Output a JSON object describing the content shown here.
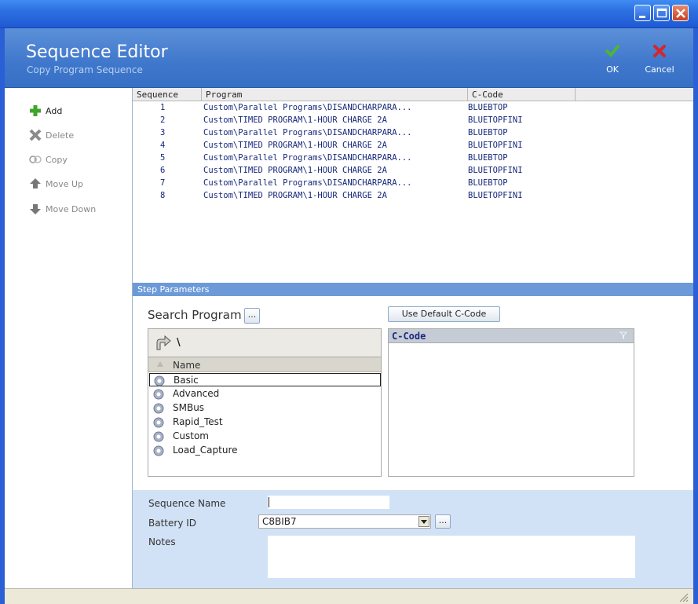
{
  "header": {
    "title": "Sequence Editor",
    "subtitle": "Copy Program Sequence",
    "ok_label": "OK",
    "cancel_label": "Cancel"
  },
  "sidebar": {
    "items": [
      {
        "label": "Add",
        "icon": "plus-icon",
        "enabled": true
      },
      {
        "label": "Delete",
        "icon": "x-icon",
        "enabled": false
      },
      {
        "label": "Copy",
        "icon": "copy-icon",
        "enabled": false
      },
      {
        "label": "Move Up",
        "icon": "arrow-up-icon",
        "enabled": false
      },
      {
        "label": "Move Down",
        "icon": "arrow-down-icon",
        "enabled": false
      }
    ]
  },
  "grid": {
    "columns": [
      "Sequence",
      "Program",
      "C-Code"
    ],
    "rows": [
      {
        "seq": "1",
        "program": "Custom\\Parallel Programs\\DISANDCHARPARA...",
        "ccode": "BLUEBTOP"
      },
      {
        "seq": "2",
        "program": "Custom\\TIMED PROGRAM\\1-HOUR CHARGE 2A",
        "ccode": "BLUETOPFINI"
      },
      {
        "seq": "3",
        "program": "Custom\\Parallel Programs\\DISANDCHARPARA...",
        "ccode": "BLUEBTOP"
      },
      {
        "seq": "4",
        "program": "Custom\\TIMED PROGRAM\\1-HOUR CHARGE 2A",
        "ccode": "BLUETOPFINI"
      },
      {
        "seq": "5",
        "program": "Custom\\Parallel Programs\\DISANDCHARPARA...",
        "ccode": "BLUEBTOP"
      },
      {
        "seq": "6",
        "program": "Custom\\TIMED PROGRAM\\1-HOUR CHARGE 2A",
        "ccode": "BLUETOPFINI"
      },
      {
        "seq": "7",
        "program": "Custom\\Parallel Programs\\DISANDCHARPARA...",
        "ccode": "BLUEBTOP"
      },
      {
        "seq": "8",
        "program": "Custom\\TIMED PROGRAM\\1-HOUR CHARGE 2A",
        "ccode": "BLUETOPFINI"
      }
    ]
  },
  "step_params": {
    "title": "Step Parameters",
    "search_label": "Search Program",
    "browse_label": "...",
    "default_ccode_label": "Use Default C-Code",
    "path": "\\",
    "list_header": "Name",
    "items": [
      "Basic",
      "Advanced",
      "SMBus",
      "Rapid_Test",
      "Custom",
      "Load_Capture"
    ],
    "selected_index": 0,
    "ccode_header": "C-Code"
  },
  "form": {
    "sequence_name_label": "Sequence Name",
    "sequence_name_value": "",
    "battery_id_label": "Battery ID",
    "battery_id_value": "C8BIB7",
    "battery_browse_label": "...",
    "notes_label": "Notes",
    "notes_value": ""
  },
  "colors": {
    "title_bar": "#2d6fe0",
    "header": "#4a7fce",
    "step_title": "#6c9ad8",
    "form_bg": "#d2e2f6",
    "grid_text": "#17287a"
  }
}
